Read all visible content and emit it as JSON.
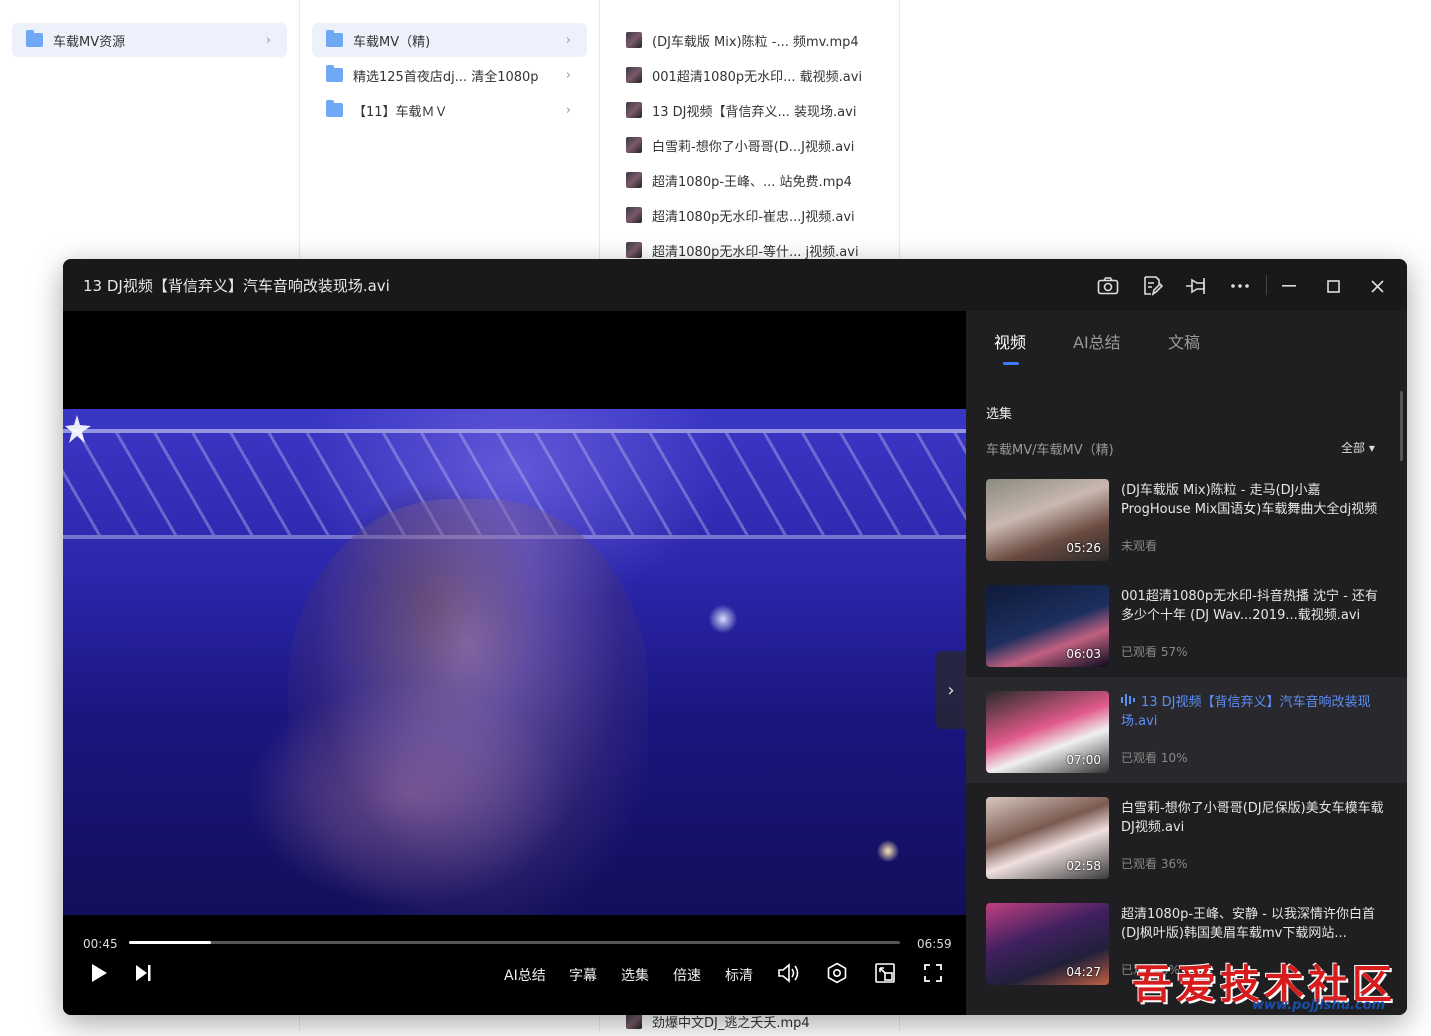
{
  "explorer": {
    "col1": [
      {
        "label": "车载MV资源",
        "selected": true
      }
    ],
    "col2": [
      {
        "label": "车载MV（精)",
        "selected": true
      },
      {
        "label": "精选125首夜店dj...  清全1080p",
        "selected": false
      },
      {
        "label": "【11】车载ＭＶ",
        "selected": false
      }
    ],
    "col3": [
      "(DJ车载版 Mix)陈粒 -... 频mv.mp4",
      "001超清1080p无水印... 载视频.avi",
      "13 DJ视频【背信弃义... 装现场.avi",
      "白雪莉-想你了小哥哥(D...J视频.avi",
      "超清1080p-王峰、... 站免费.mp4",
      "超清1080p无水印-崔忠...J视频.avi",
      "超清1080p无水印-等什... j视频.avi"
    ],
    "bottom_file": "劲爆中文DJ_逃之夭夭.mp4"
  },
  "player": {
    "title": "13 DJ视频【背信弃义】汽车音响改装现场.avi",
    "icons": [
      "camera-icon",
      "note-edit-icon",
      "pin-icon",
      "more-icon",
      "minimize-icon",
      "maximize-icon",
      "close-icon"
    ],
    "time_current": "00:45",
    "time_total": "06:59",
    "progress": 0.107,
    "controls": {
      "ai_summary": "AI总结",
      "subtitle": "字幕",
      "episodes": "选集",
      "speed": "倍速",
      "quality": "标清"
    }
  },
  "sidebar": {
    "tabs": [
      "视频",
      "AI总结",
      "文稿"
    ],
    "active_tab": 0,
    "section": "选集",
    "path": "车载MV/车载MV（精)",
    "filter": "全部",
    "items": [
      {
        "title": "(DJ车载版 Mix)陈粒 - 走马(DJ小嘉 ProgHouse Mix国语女)车载舞曲大全dj视频mv.m...",
        "duration": "05:26",
        "status": "未观看",
        "playing": false
      },
      {
        "title": "001超清1080p无水印-抖音热播 沈宁 - 还有多少个十年 (DJ Wav...2019...载视频.avi",
        "duration": "06:03",
        "status": "已观看 57%",
        "playing": false
      },
      {
        "title": "13 DJ视频【背信弃义】汽车音响改装现场.avi",
        "duration": "07:00",
        "status": "已观看 10%",
        "playing": true
      },
      {
        "title": "白雪莉-想你了小哥哥(DJ尼保版)美女车模车载DJ视频.avi",
        "duration": "02:58",
        "status": "已观看 36%",
        "playing": false
      },
      {
        "title": "超清1080p-王峰、安静 - 以我深情许你白首 (DJ枫叶版)韩国美眉车载mv下载网站...",
        "duration": "04:27",
        "status": "已观看 0%",
        "playing": false
      }
    ]
  },
  "watermark": {
    "text": "吾爱技术社区",
    "url": "www.pojjishu.com"
  },
  "colors": {
    "accent": "#3f7cf7",
    "playing_text": "#5b8ef7",
    "watermark": "#d61c1c"
  }
}
